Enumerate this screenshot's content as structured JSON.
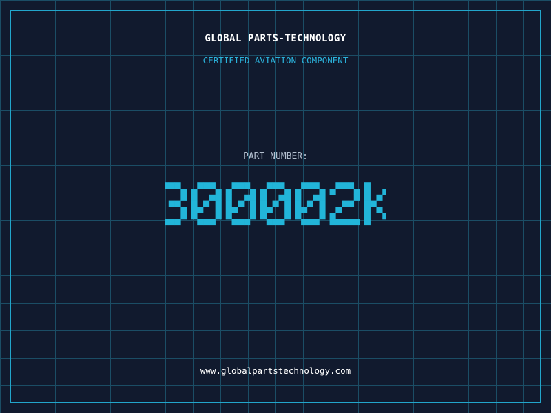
{
  "company_name": "GLOBAL PARTS-TECHNOLOGY",
  "tagline": "CERTIFIED AVIATION COMPONENT",
  "part_label": "PART NUMBER:",
  "part_number": "300002K",
  "website": "www.globalpartstechnology.com",
  "colors": {
    "background": "#111a2e",
    "grid_line": "#1f5f78",
    "border": "#22a6cc",
    "accent": "#2bb3dc",
    "part_number": "#22b5d9",
    "title_text": "#ffffff",
    "label_text": "#b4c0d0"
  }
}
